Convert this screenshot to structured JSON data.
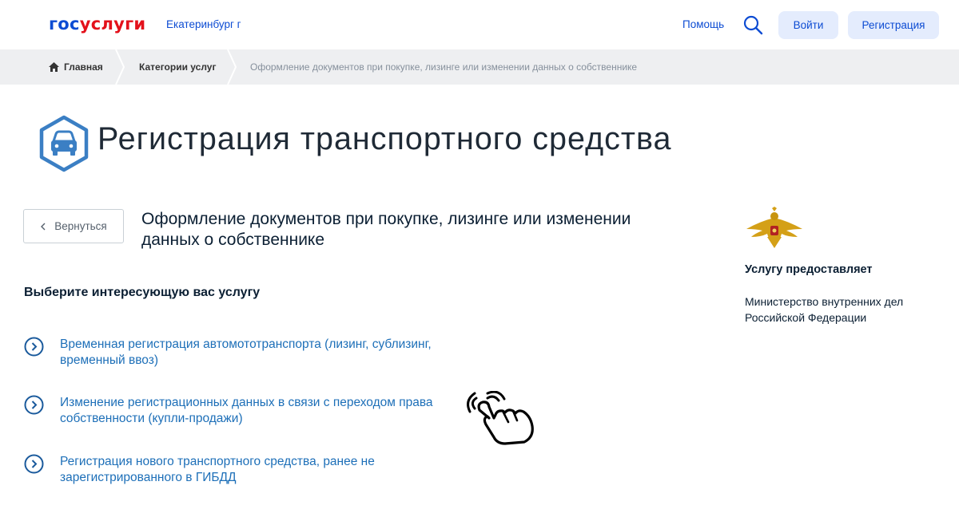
{
  "header": {
    "logo_part1": "гос",
    "logo_part2": "услуги",
    "city": "Екатеринбург г",
    "help": "Помощь",
    "login": "Войти",
    "register": "Регистрация"
  },
  "breadcrumbs": {
    "home": "Главная",
    "category": "Категории услуг",
    "current": "Оформление документов при покупке, лизинге или изменении данных о собственнике"
  },
  "page": {
    "title": "Регистрация транспортного средства",
    "title_icon": "car-icon",
    "back_label": "Вернуться",
    "subtitle": "Оформление документов при покупке, лизинге или изменении данных о собственнике",
    "choose_label": "Выберите интересующую вас услугу"
  },
  "services": [
    {
      "label": "Временная регистрация автомототранспорта (лизинг, сублизинг, временный ввоз)"
    },
    {
      "label": "Изменение регистрационных данных в связи с переходом права собственности (купли-продажи)"
    },
    {
      "label": "Регистрация нового транспортного средства, ранее не зарегистрированного в ГИБДД"
    }
  ],
  "provider": {
    "label": "Услугу предоставляет",
    "name": "Министерство внутренних дел Российской Федерации",
    "emblem": "mvd-eagle-emblem"
  },
  "colors": {
    "brand_blue": "#0d4cd3",
    "brand_red": "#e3111b",
    "link_blue": "#1d6fb8",
    "icon_blue": "#3b7fc4",
    "button_bg": "#e4ecfd",
    "breadcrumb_bg": "#eeeff1"
  }
}
